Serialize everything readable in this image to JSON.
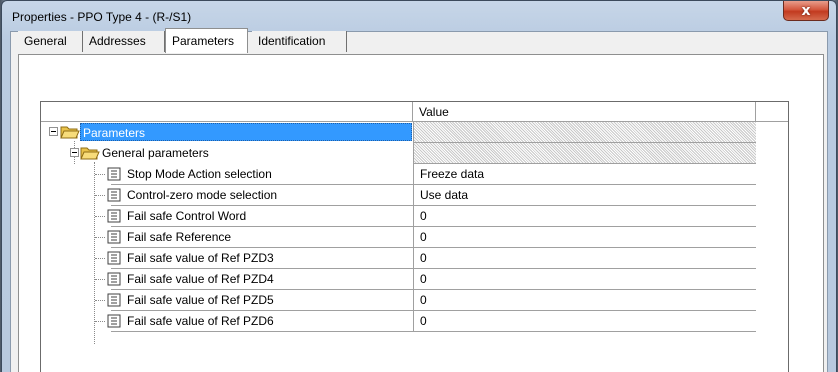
{
  "window": {
    "title": "Properties - PPO Type 4 - (R-/S1)",
    "close_glyph": "x"
  },
  "tabs": [
    {
      "label": "General",
      "active": false
    },
    {
      "label": "Addresses",
      "active": false
    },
    {
      "label": "Parameters",
      "active": true
    },
    {
      "label": "Identification",
      "active": false
    }
  ],
  "grid": {
    "columns": [
      "",
      "Value"
    ],
    "root": {
      "label": "Parameters",
      "icon": "open-folder-icon",
      "selected": true
    },
    "group": {
      "label": "General parameters",
      "icon": "open-folder-icon"
    },
    "items": [
      {
        "label": "Stop Mode Action selection",
        "value": "Freeze data"
      },
      {
        "label": "Control-zero mode selection",
        "value": "Use data"
      },
      {
        "label": "Fail safe Control Word",
        "value": "0"
      },
      {
        "label": "Fail safe Reference",
        "value": "0"
      },
      {
        "label": "Fail safe value of Ref PZD3",
        "value": "0"
      },
      {
        "label": "Fail safe value of Ref PZD4",
        "value": "0"
      },
      {
        "label": "Fail safe value of Ref PZD5",
        "value": "0"
      },
      {
        "label": "Fail safe value of Ref PZD6",
        "value": "0"
      }
    ]
  },
  "colors": {
    "selection": "#3399ff",
    "close_button": "#c94a2f"
  }
}
